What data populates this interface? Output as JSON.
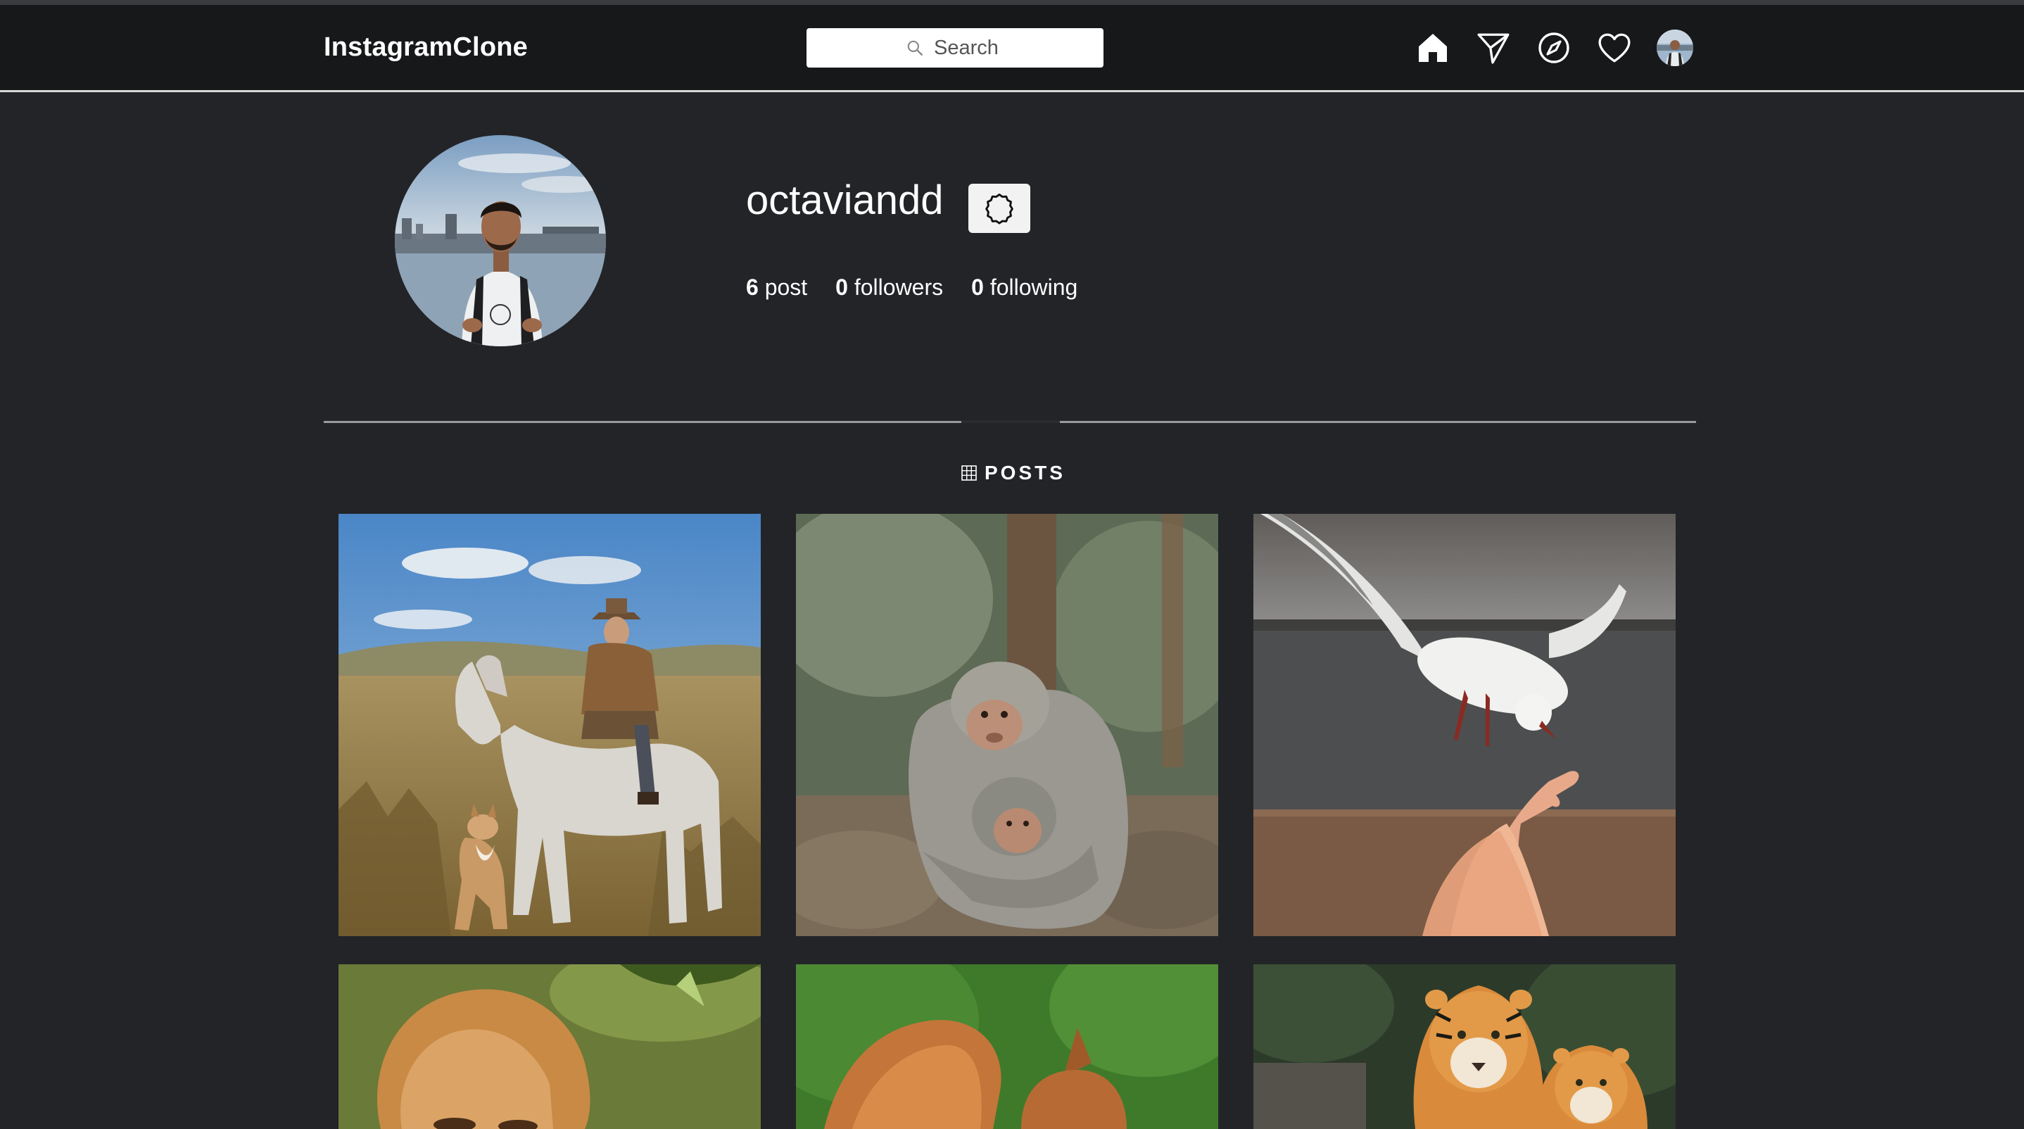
{
  "navbar": {
    "brand": "InstagramClone",
    "search_placeholder": "Search",
    "icons": [
      "home-icon",
      "direct-message-icon",
      "explore-compass-icon",
      "heart-icon",
      "avatar"
    ]
  },
  "profile": {
    "username": "octaviandd",
    "stats": [
      {
        "count": "6",
        "label": "post"
      },
      {
        "count": "0",
        "label": "followers"
      },
      {
        "count": "0",
        "label": "following"
      }
    ]
  },
  "tabs": {
    "posts_label": "POSTS"
  },
  "posts": [
    {
      "subject": "man on white horse with dog"
    },
    {
      "subject": "monkey hugging baby"
    },
    {
      "subject": "seagull eating from hand"
    },
    {
      "subject": "lion"
    },
    {
      "subject": "squirrel"
    },
    {
      "subject": "two tigers"
    }
  ],
  "colors": {
    "background": "#232428",
    "navbar": "#17181a",
    "text": "#ffffff",
    "divider": "#9a9a9c"
  }
}
